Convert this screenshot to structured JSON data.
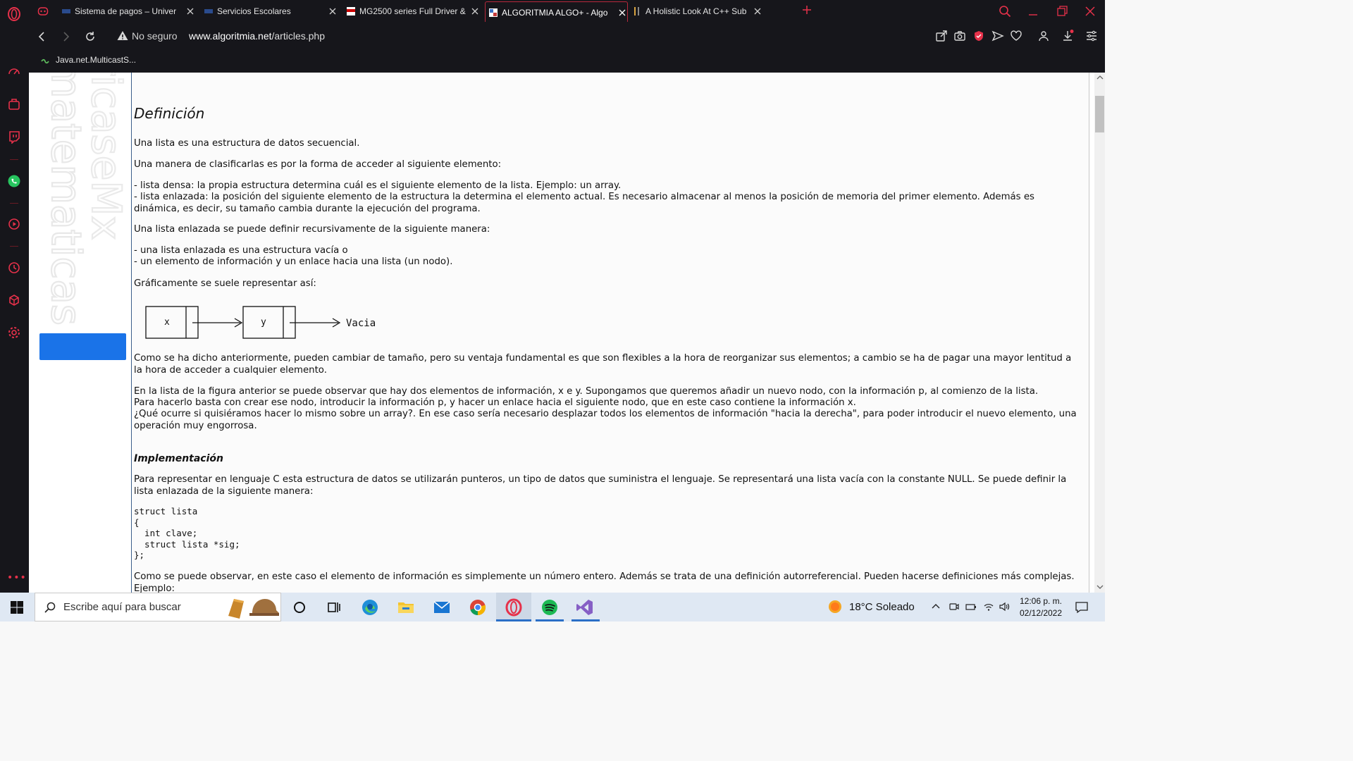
{
  "browser": {
    "tabs": [
      {
        "title": "Sistema de pagos – Univer",
        "active": false
      },
      {
        "title": "Servicios Escolares",
        "active": false
      },
      {
        "title": "MG2500 series Full Driver &",
        "active": false
      },
      {
        "title": "ALGORITMIA ALGO+ - Algo",
        "active": true
      },
      {
        "title": "A Holistic Look At C++ Sub",
        "active": false
      }
    ],
    "security_label": "No seguro",
    "url_domain": "www.algoritmia.net",
    "url_path": "/articles.php",
    "bookmark": "Java.net.MulticastS..."
  },
  "article": {
    "definition_heading": "Definición",
    "p1": "Una lista es una estructura de datos secuencial.",
    "p2": "Una manera de clasificarlas es por la forma de acceder al siguiente elemento:",
    "bullet1": "- lista densa: la propia estructura determina cuál es el siguiente elemento de la lista. Ejemplo: un array.",
    "bullet2": "- lista enlazada: la posición del siguiente elemento de la estructura la determina el elemento actual. Es necesario almacenar al menos la posición de memoria del primer elemento. Además es dinámica, es decir, su tamaño cambia durante la ejecución del programa.",
    "p3": "Una lista enlazada se puede definir recursivamente de la siguiente manera:",
    "bullet3": "- una lista enlazada es una estructura vacía o",
    "bullet4": "- un elemento de información y un enlace hacia una lista (un nodo).",
    "p4": "Gráficamente se suele representar así:",
    "diagram": {
      "node1": "x",
      "node2": "y",
      "end": "Vacia"
    },
    "p5": "Como se ha dicho anteriormente, pueden cambiar de tamaño, pero su ventaja fundamental es que son flexibles a la hora de reorganizar sus elementos; a cambio se ha de pagar una mayor lentitud a la hora de acceder a cualquier elemento.",
    "p6a": "En la lista de la figura anterior se puede observar que hay dos elementos de información, x e y. Supongamos que queremos añadir un nuevo nodo, con la información p, al comienzo de la lista.",
    "p6b": "Para hacerlo basta con crear ese nodo, introducir la información p, y hacer un enlace hacia el siguiente nodo, que en este caso contiene la información x.",
    "p6c": "¿Qué ocurre si quisiéramos hacer lo mismo sobre un array?. En ese caso sería necesario desplazar todos los elementos de información \"hacia la derecha\", para poder introducir el nuevo elemento, una operación muy engorrosa.",
    "impl_heading": "Implementación",
    "p7": "Para representar en lenguaje C esta estructura de datos se utilizarán punteros, un tipo de datos que suministra el lenguaje. Se representará una lista vacía con la constante NULL. Se puede definir la lista enlazada de la siguiente manera:",
    "code": "struct lista\n{\n  int clave;\n  struct lista *sig;\n};",
    "p8": "Como se puede observar, en este caso el elemento de información es simplemente un número entero. Además se trata de una definición autorreferencial. Pueden hacerse definiciones más complejas. Ejemplo:"
  },
  "taskbar": {
    "search_placeholder": "Escribe aquí para buscar",
    "weather": "18°C  Soleado",
    "time": "12:06 p. m.",
    "date": "02/12/2022"
  },
  "colors": {
    "chrome_bg": "#16161b",
    "opera_red": "#e6314a",
    "taskbar_bg": "#dfe8f3",
    "accent_blue": "#1a73e8"
  }
}
